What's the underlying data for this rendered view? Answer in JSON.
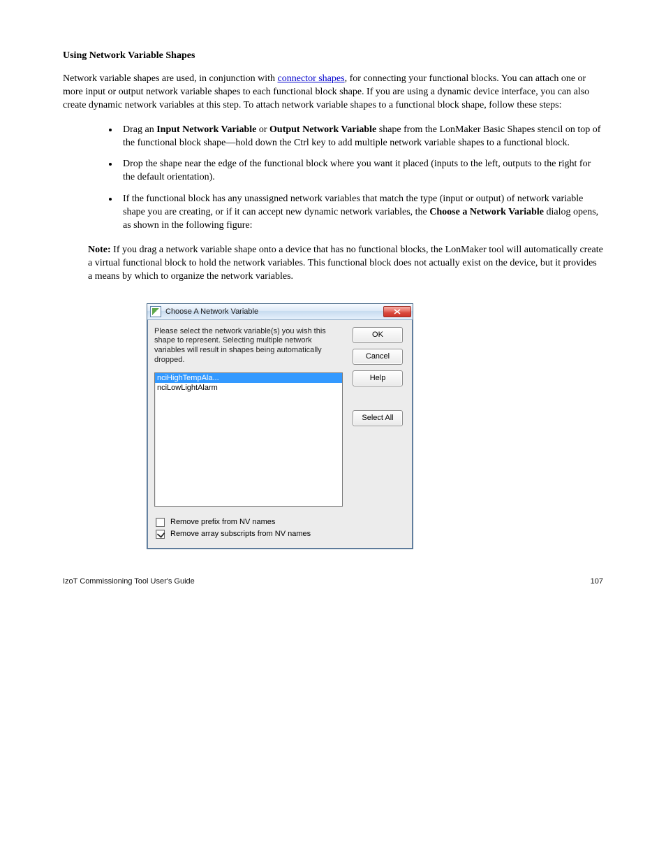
{
  "heading": "Using Network Variable Shapes",
  "para1_prefix": "Network variable shapes are used, in conjunction with ",
  "para1_link": "connector shapes",
  "para1_rest": ", for connecting your functional blocks. You can attach one or more input or output network variable shapes to each functional block shape. If you are using a dynamic device interface, you can also create dynamic network variables at this step. To attach network variable shapes to a functional block shape, follow these steps:",
  "bullets": [
    {
      "prefix": "Drag an ",
      "bold1": "Input Network Variable",
      "mid": " or ",
      "bold2": "Output Network Variable",
      "suffix": " shape from the LonMaker Basic Shapes stencil on top of the functional block shape—hold down the Ctrl key to add multiple network variable shapes to a functional block."
    },
    {
      "text": "Drop the shape near the edge of the functional block where you want it placed (inputs to the left, outputs to the right for the default orientation)."
    },
    {
      "prefix": "If the functional block has any unassigned network variables that match the type (input or output) of network variable shape you are creating, or if it can accept new dynamic network variables, the ",
      "bold1": "Choose a Network Variable",
      "suffix": " dialog opens, as shown in the following figure:"
    }
  ],
  "dialog": {
    "title": "Choose A Network Variable",
    "instructions": "Please select the network variable(s) you wish this shape to represent. Selecting multiple network variables will result in shapes being automatically dropped.",
    "items": [
      {
        "label": "nciHighTempAla...",
        "selected": true
      },
      {
        "label": "nciLowLightAlarm",
        "selected": false
      }
    ],
    "buttons": {
      "ok": "OK",
      "cancel": "Cancel",
      "help": "Help",
      "select_all": "Select All"
    },
    "checkbox1": {
      "label": "Remove prefix from NV names",
      "checked": false
    },
    "checkbox2": {
      "label": "Remove array subscripts from NV names",
      "checked": true
    }
  },
  "footer": {
    "left": "IzoT Commissioning Tool User's Guide",
    "right": "107"
  }
}
